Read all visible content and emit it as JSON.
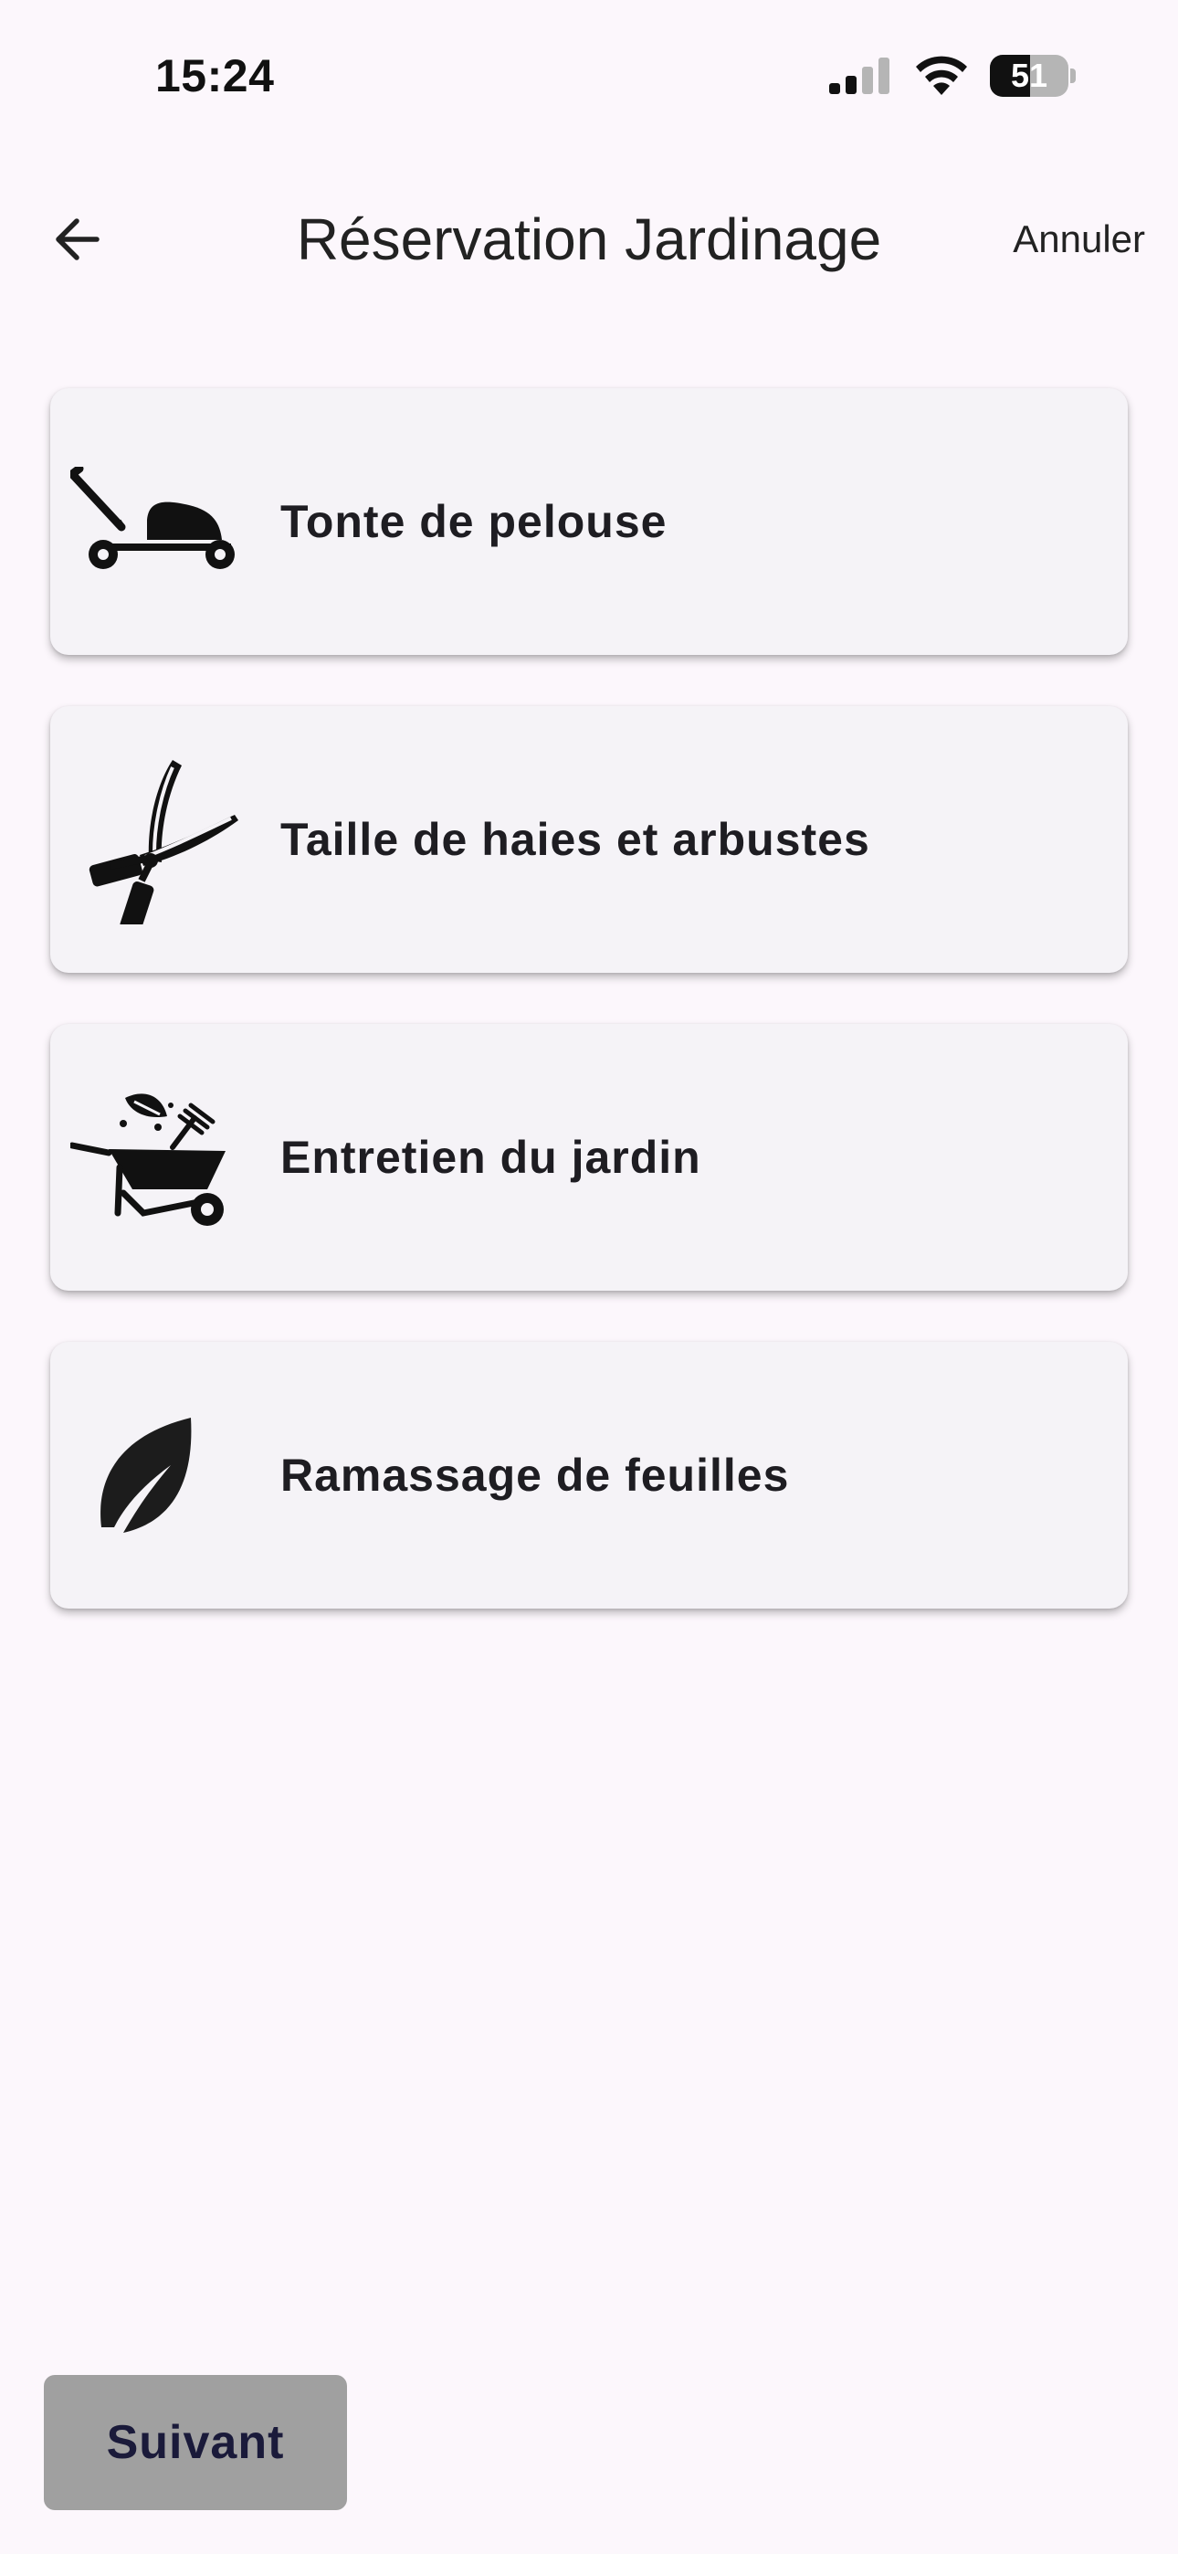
{
  "status_bar": {
    "time": "15:24",
    "battery_level": "51",
    "battery_fraction": 0.51
  },
  "header": {
    "back_icon": "arrow-left-icon",
    "title": "Réservation Jardinage",
    "cancel_label": "Annuler"
  },
  "services": [
    {
      "label": "Tonte de pelouse",
      "icon": "lawn-mower-icon"
    },
    {
      "label": "Taille de haies et arbustes",
      "icon": "hedge-shears-icon"
    },
    {
      "label": "Entretien du jardin",
      "icon": "wheelbarrow-icon"
    },
    {
      "label": "Ramassage de feuilles",
      "icon": "leaf-icon"
    }
  ],
  "footer": {
    "next_label": "Suivant"
  },
  "colors": {
    "background": "#fcf7fc",
    "card": "#f5f3f7",
    "next_button": "#a0a0a0",
    "next_text": "#1a1a3a"
  }
}
